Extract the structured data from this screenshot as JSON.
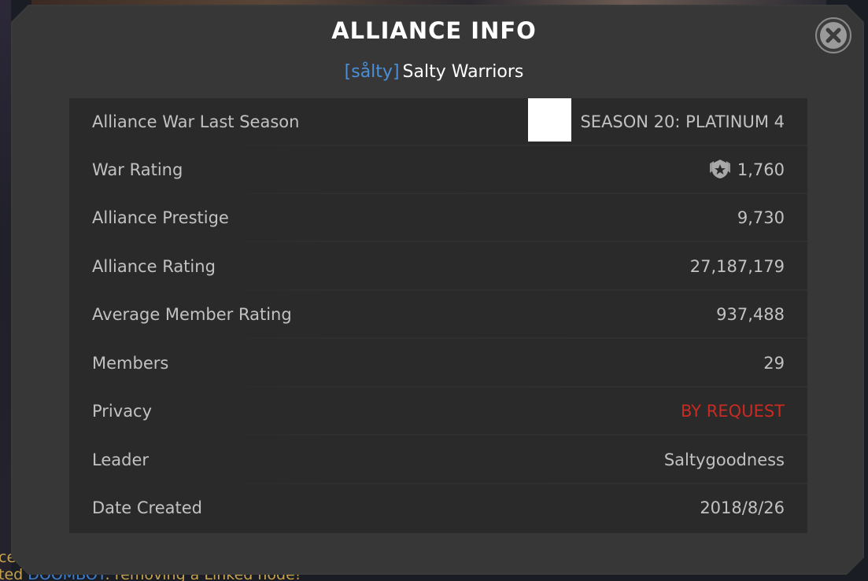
{
  "dialog": {
    "title": "ALLIANCE INFO",
    "alliance_tag": "[sålty]",
    "alliance_name": "Salty Warriors",
    "close_icon": "close-icon"
  },
  "rows": [
    {
      "label": "Alliance War Last Season",
      "value": "SEASON 20: PLATINUM 4"
    },
    {
      "label": "War Rating",
      "value": "1,760",
      "icon": "war-rating-icon"
    },
    {
      "label": "Alliance Prestige",
      "value": "9,730"
    },
    {
      "label": "Alliance Rating",
      "value": "27,187,179"
    },
    {
      "label": "Average Member Rating",
      "value": "937,488"
    },
    {
      "label": "Members",
      "value": "29"
    },
    {
      "label": "Privacy",
      "value": "BY REQUEST",
      "color": "#c92a22"
    },
    {
      "label": "Leader",
      "value": "Saltygoodness"
    },
    {
      "label": "Date Created",
      "value": "2018/8/26"
    }
  ],
  "background_chat": {
    "line1": "ced",
    "line2_prefix": "ted",
    "line2_name": "DOOMBOT",
    "line2_text": ": removing a Linked node!"
  },
  "colors": {
    "accent_tag": "#4a8fd8",
    "privacy_red": "#c92a22",
    "chat_gold": "#c7a24a"
  }
}
